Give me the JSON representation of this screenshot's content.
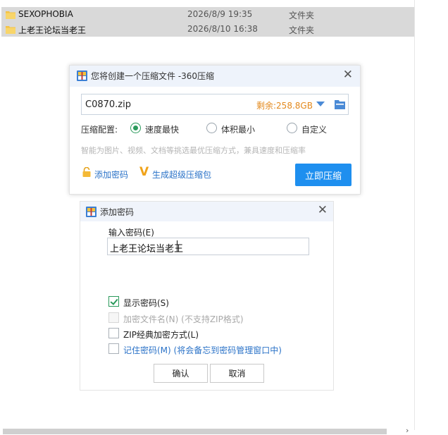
{
  "files": [
    {
      "name": "SEXOPHOBIA",
      "date": "2026/8/9 19:35",
      "type": "文件夹"
    },
    {
      "name": "上老王论坛当老王",
      "date": "2026/8/10 16:38",
      "type": "文件夹"
    }
  ],
  "compress_dialog": {
    "title": "您将创建一个压缩文件 -360压缩",
    "close_glyph": "✕",
    "filename": "C0870.zip",
    "free_space": "剩余:258.8GB",
    "config_label": "压缩配置:",
    "options": [
      {
        "label": "速度最快",
        "selected": true
      },
      {
        "label": "体积最小",
        "selected": false
      },
      {
        "label": "自定义",
        "selected": false
      }
    ],
    "hint": "智能为图片、视频、文档等挑选最优压缩方式，兼具速度和压缩率",
    "add_password": "添加密码",
    "super_v": "V",
    "super_compress": "生成超级压缩包",
    "compress_now": "立即压缩"
  },
  "password_dialog": {
    "title": "添加密码",
    "close_glyph": "✕",
    "input_label": "输入密码(E)",
    "password_value": "上老王论坛当老王",
    "options": [
      {
        "label": "显示密码(S)",
        "checked": true,
        "disabled": false
      },
      {
        "label": "加密文件名(N) (不支持ZIP格式)",
        "checked": false,
        "disabled": true
      },
      {
        "label": "ZIP经典加密方式(L)",
        "checked": false,
        "disabled": false
      },
      {
        "label": "记住密码(M) (将会备忘到密码管理窗口中)",
        "checked": false,
        "disabled": false
      }
    ],
    "ok": "确认",
    "cancel": "取消"
  },
  "scroll_arrow": "›",
  "colors": {
    "accent": "#1e8fef",
    "check": "#2a9a5b",
    "link": "#2b73c8",
    "space": "#e3891c",
    "folder": "#f5c244"
  }
}
